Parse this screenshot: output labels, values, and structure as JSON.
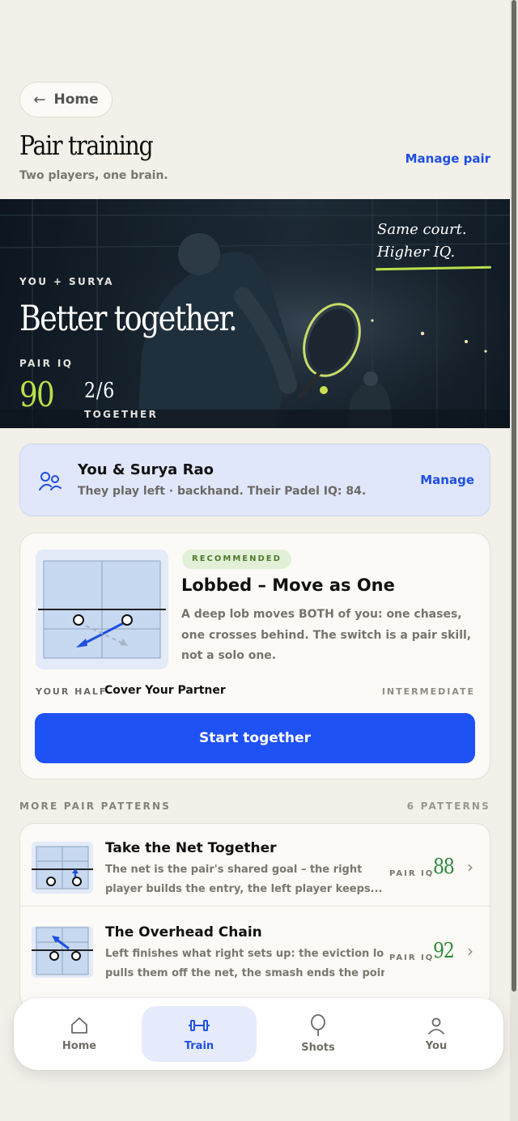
{
  "header": {
    "back_label": "Home",
    "title": "Pair training",
    "subtitle": "Two players, one brain.",
    "manage_pair_label": "Manage pair"
  },
  "hero": {
    "eyebrow": "YOU + SURYA",
    "title": "Better together.",
    "iq_label": "PAIR IQ",
    "iq_value": "90",
    "count_value": "2/6",
    "count_label": "TOGETHER",
    "script_line1": "Same court.",
    "script_line2": "Higher IQ.",
    "accent_color": "#b9e04a"
  },
  "partner": {
    "name": "You & Surya Rao",
    "description": "They play left · backhand. Their Padel IQ: 84.",
    "manage_label": "Manage",
    "icon": "pair-users-icon"
  },
  "recommended": {
    "badge": "RECOMMENDED",
    "title": "Lobbed – Move as One",
    "description_lines": [
      "A deep lob moves BOTH of you: one chases,",
      "one crosses behind. The switch is a pair skill,",
      "not a solo one."
    ],
    "half_label": "YOUR HALF",
    "half_value": "Cover Your Partner",
    "level": "INTERMEDIATE",
    "cta_label": "Start together"
  },
  "more": {
    "label": "MORE PAIR PATTERNS",
    "count": "6 PATTERNS",
    "items": [
      {
        "title": "Take the Net Together",
        "desc_lines": [
          "The net is the pair's shared goal – the right",
          "player builds the entry, the left player keeps..."
        ],
        "iq_label": "PAIR IQ",
        "iq_value": "88"
      },
      {
        "title": "The Overhead Chain",
        "desc_lines": [
          "Left finishes what right sets up: the eviction lob",
          "pulls them off the net, the smash ends the point."
        ],
        "iq_label": "PAIR IQ",
        "iq_value": "92"
      }
    ]
  },
  "tabbar": {
    "items": [
      {
        "label": "Home",
        "icon": "house-icon"
      },
      {
        "label": "Train",
        "icon": "dumbbell-icon",
        "active": true
      },
      {
        "label": "Shots",
        "icon": "racket-icon"
      },
      {
        "label": "You",
        "icon": "person-icon"
      }
    ]
  },
  "colors": {
    "background": "#f2f0e9",
    "primary": "#1f52f5",
    "link": "#1f4fe0",
    "iq_green": "#2f8a3c"
  }
}
